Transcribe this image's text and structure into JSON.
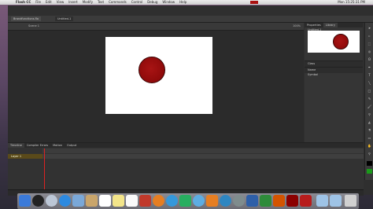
{
  "menubar": {
    "app_name": "Flash CC",
    "items": [
      "File",
      "Edit",
      "View",
      "Insert",
      "Modify",
      "Text",
      "Commands",
      "Control",
      "Debug",
      "Window",
      "Help"
    ],
    "clock": "Mon 15:25:31 PM"
  },
  "document_tabs": [
    "Brandfunctions.fla",
    "Untitled-1"
  ],
  "edit_bar": {
    "scene": "Scene 1",
    "zoom": "100%"
  },
  "stage": {
    "background": "#ffffff",
    "object_color": "#8e0a0a"
  },
  "panel": {
    "tabs": [
      "Properties",
      "Library"
    ],
    "doc_label": "Untitled-1",
    "class_label": "Class",
    "section_label": "Name",
    "symbol_item": "Symbol"
  },
  "timeline": {
    "tabs": [
      "Timeline",
      "Compiler Errors",
      "Motion",
      "Output"
    ],
    "layer_name": "Layer 1"
  },
  "dock": {
    "icons": [
      "finder-icon",
      "dashboard-icon",
      "launchpad-icon",
      "safari-icon",
      "mail-icon",
      "contacts-icon",
      "calendar-icon",
      "notes-icon",
      "reminders-icon",
      "maps-icon",
      "photos-icon",
      "messages-icon",
      "facetime-icon",
      "itunes-icon",
      "ibooks-icon",
      "app-store-icon",
      "system-preferences-icon",
      "word-icon",
      "excel-icon",
      "powerpoint-icon",
      "flash-icon",
      "acrobat-icon",
      "folder-icon",
      "downloads-icon",
      "trash-icon"
    ]
  }
}
